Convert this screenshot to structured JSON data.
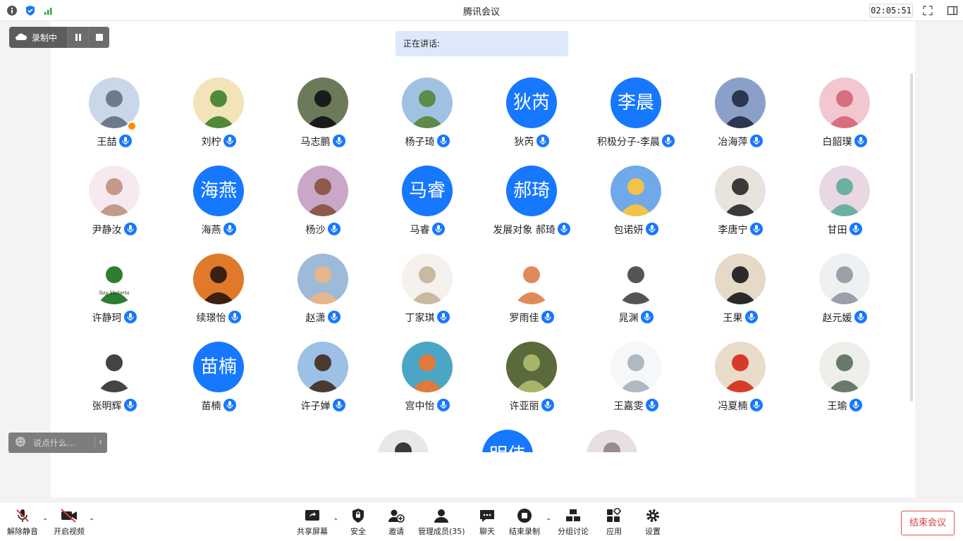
{
  "window": {
    "title": "腾讯会议",
    "timer": "02:05:51"
  },
  "recording": {
    "label": "录制中"
  },
  "speaking": {
    "label": "正在讲话:"
  },
  "chat": {
    "placeholder": "说点什么..."
  },
  "participants": [
    {
      "name": "王喆",
      "avatar": "photo",
      "host": true
    },
    {
      "name": "刘柠",
      "avatar": "photo"
    },
    {
      "name": "马志鹏",
      "avatar": "photo"
    },
    {
      "name": "杨子琦",
      "avatar": "photo"
    },
    {
      "name": "狄芮",
      "avatar": "text",
      "avatar_text": "狄芮"
    },
    {
      "name": "积极分子-李晨",
      "avatar": "text",
      "avatar_text": "李晨"
    },
    {
      "name": "冶海萍",
      "avatar": "photo"
    },
    {
      "name": "白韶璞",
      "avatar": "photo"
    },
    {
      "name": "尹静汝",
      "avatar": "photo"
    },
    {
      "name": "海燕",
      "avatar": "text",
      "avatar_text": "海燕"
    },
    {
      "name": "杨沙",
      "avatar": "photo"
    },
    {
      "name": "马睿",
      "avatar": "text",
      "avatar_text": "马睿"
    },
    {
      "name": "发展对象 郝琦",
      "avatar": "text",
      "avatar_text": "郝琦"
    },
    {
      "name": "包诺妍",
      "avatar": "photo"
    },
    {
      "name": "李唐宁",
      "avatar": "photo"
    },
    {
      "name": "甘田",
      "avatar": "photo"
    },
    {
      "name": "许静珂",
      "avatar": "photo",
      "avatar_caption": "Say Victoria"
    },
    {
      "name": "续璟怡",
      "avatar": "photo"
    },
    {
      "name": "赵潇",
      "avatar": "photo"
    },
    {
      "name": "丁家琪",
      "avatar": "photo"
    },
    {
      "name": "罗雨佳",
      "avatar": "photo"
    },
    {
      "name": "晁渊",
      "avatar": "photo"
    },
    {
      "name": "王果",
      "avatar": "photo"
    },
    {
      "name": "赵元媛",
      "avatar": "photo"
    },
    {
      "name": "张明辉",
      "avatar": "photo"
    },
    {
      "name": "苗楠",
      "avatar": "text",
      "avatar_text": "苗楠"
    },
    {
      "name": "许子婵",
      "avatar": "photo"
    },
    {
      "name": "宫中怡",
      "avatar": "photo"
    },
    {
      "name": "许亚丽",
      "avatar": "photo"
    },
    {
      "name": "王嘉雯",
      "avatar": "photo"
    },
    {
      "name": "冯夏楠",
      "avatar": "photo"
    },
    {
      "name": "王瑜",
      "avatar": "photo"
    },
    {
      "name": "",
      "avatar": "photo"
    },
    {
      "name": "",
      "avatar": "text",
      "avatar_text": "明伟"
    },
    {
      "name": "",
      "avatar": "photo"
    }
  ],
  "toolbar": {
    "unmute": "解除静音",
    "start_video": "开启视频",
    "share_screen": "共享屏幕",
    "security": "安全",
    "invite": "邀请",
    "manage_members": "管理成员(35)",
    "chat": "聊天",
    "end_recording": "结束录制",
    "breakout": "分组讨论",
    "apps": "应用",
    "settings": "设置",
    "end_meeting": "结束会议"
  },
  "colors": {
    "accent": "#1677ff",
    "danger": "#e03b3b",
    "speaking_bg": "#dde9fb"
  }
}
